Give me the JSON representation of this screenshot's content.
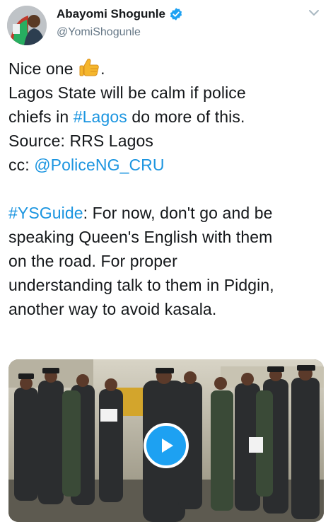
{
  "user": {
    "display_name": "Abayomi Shogunle",
    "handle": "@YomiShogunle",
    "verified_icon": "verified-badge-icon",
    "menu_icon": "chevron-down-icon"
  },
  "tweet": {
    "line1_text": "Nice one ",
    "line1_emoji": "👍",
    "line1_suffix": ".",
    "line2_pre": "Lagos State will be calm if police",
    "line3_pre": "chiefs in ",
    "line3_link": "#Lagos",
    "line3_post": " do more of this.",
    "line4": "Source: RRS Lagos",
    "line5_pre": "cc: ",
    "line5_link": "@PoliceNG_CRU",
    "line7_link": "#YSGuide",
    "line7_post": ": For now, don't go and be",
    "line8": "speaking Queen's English with them",
    "line9": "on the road. For proper",
    "line10": "understanding talk to them in Pidgin,",
    "line11": "another way to avoid kasala."
  },
  "media": {
    "type": "video",
    "play_icon": "play-icon"
  },
  "colors": {
    "link": "#1b95e0",
    "verified": "#1da1f2",
    "play_button": "#1da1f2",
    "handle": "#657786"
  }
}
